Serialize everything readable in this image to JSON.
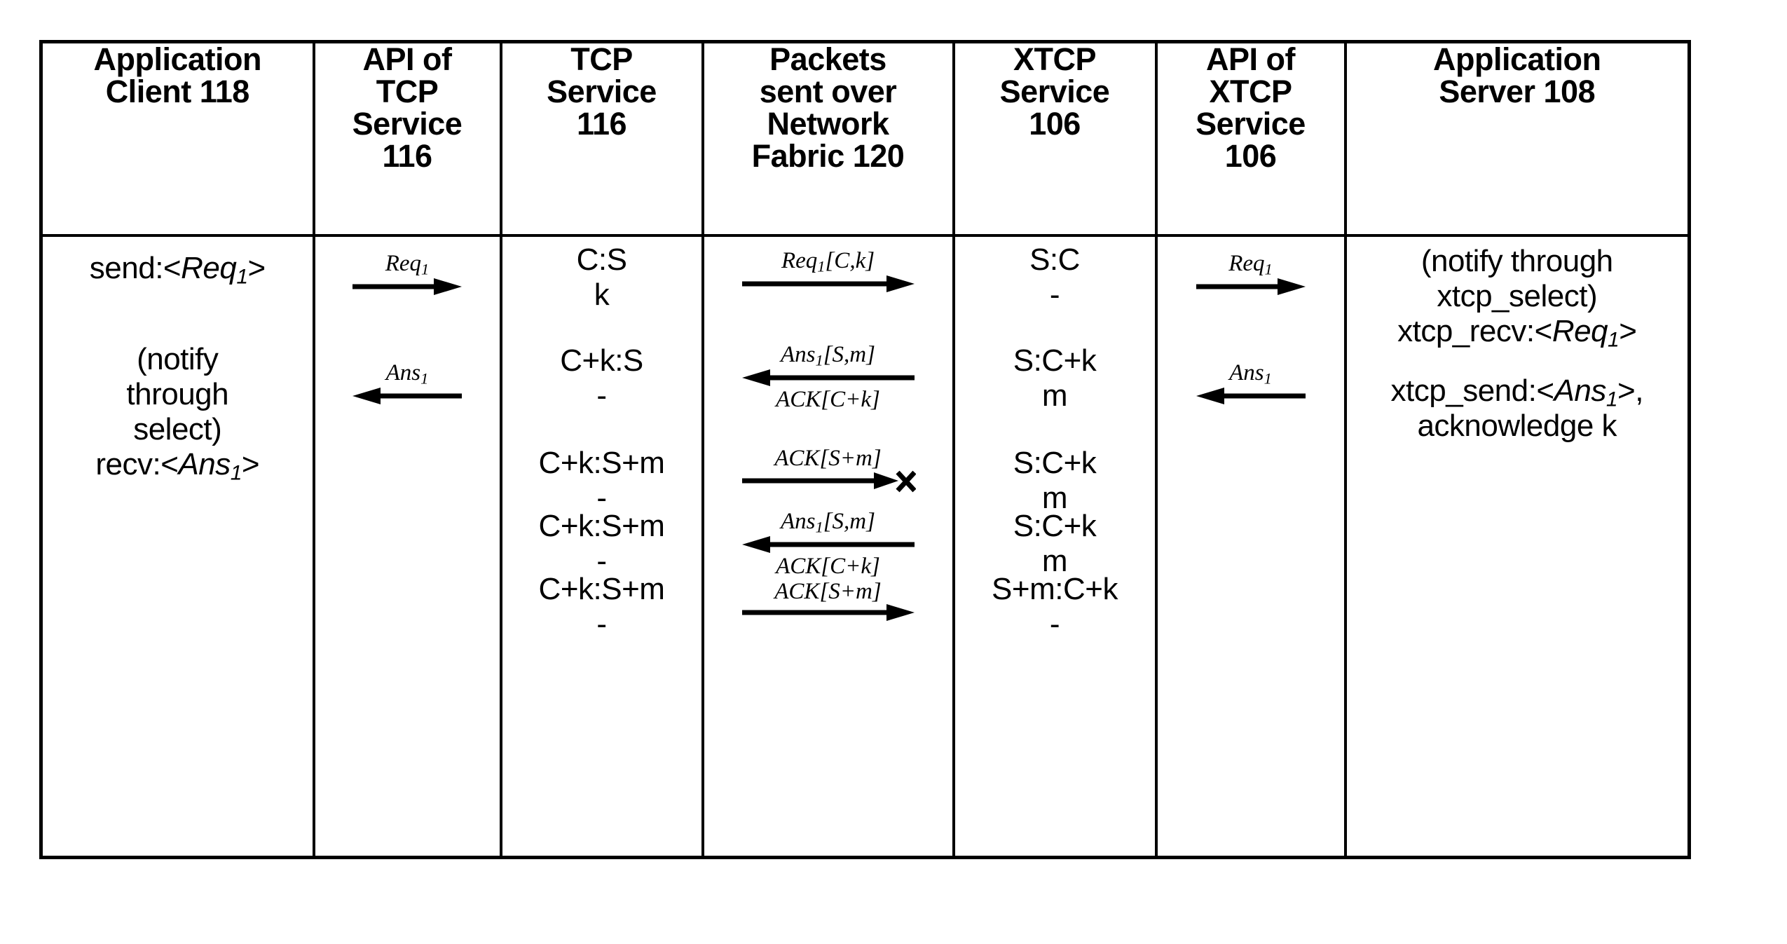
{
  "figure": {
    "type": "sequence-table",
    "columns": [
      {
        "id": "app-client",
        "header_lines": [
          "Application",
          "Client 118"
        ]
      },
      {
        "id": "api-tcp",
        "header_lines": [
          "API of",
          "TCP",
          "Service",
          "116"
        ]
      },
      {
        "id": "tcp-service",
        "header_lines": [
          "TCP",
          "Service",
          "116"
        ]
      },
      {
        "id": "packets",
        "header_lines": [
          "Packets",
          "sent over",
          "Network",
          "Fabric 120"
        ]
      },
      {
        "id": "xtcp-service",
        "header_lines": [
          "XTCP",
          "Service",
          "106"
        ]
      },
      {
        "id": "api-xtcp",
        "header_lines": [
          "API of",
          "XTCP",
          "Service",
          "106"
        ]
      },
      {
        "id": "app-server",
        "header_lines": [
          "Application",
          "Server 108"
        ]
      }
    ]
  },
  "app_client": {
    "send_req": {
      "prefix": "send:<",
      "name": "Req",
      "sub": "1",
      "suffix": ">"
    },
    "notify_line1": "(notify",
    "notify_line2": "through",
    "notify_line3": "select)",
    "recv_ans": {
      "prefix": "recv:<",
      "name": "Ans",
      "sub": "1",
      "suffix": ">"
    }
  },
  "api_tcp": {
    "arrow1": {
      "label_name": "Req",
      "label_sub": "1",
      "direction": "right"
    },
    "arrow2": {
      "label_name": "Ans",
      "label_sub": "1",
      "direction": "left"
    }
  },
  "tcp_service": {
    "states": [
      {
        "line1": "C:S",
        "line2": "k"
      },
      {
        "line1": "C+k:S",
        "line2": "-"
      },
      {
        "line1": "C+k:S+m",
        "line2": "-"
      },
      {
        "line1": "C+k:S+m",
        "line2": "-"
      },
      {
        "line1": "C+k:S+m",
        "line2": "-"
      }
    ]
  },
  "packets": {
    "messages": [
      {
        "above": "Req₁[C,k]",
        "above_name": "Req",
        "above_sub": "1",
        "above_rest": "[C,k]",
        "below": "",
        "direction": "right",
        "lost": false
      },
      {
        "above": "Ans₁[S,m]",
        "above_name": "Ans",
        "above_sub": "1",
        "above_rest": "[S,m]",
        "below": "ACK[C+k]",
        "direction": "left",
        "lost": false
      },
      {
        "above": "ACK[S+m]",
        "above_name": "",
        "above_sub": "",
        "above_rest": "ACK[S+m]",
        "below": "",
        "direction": "right",
        "lost": true
      },
      {
        "above": "Ans₁[S,m]",
        "above_name": "Ans",
        "above_sub": "1",
        "above_rest": "[S,m]",
        "below": "ACK[C+k]",
        "direction": "left",
        "lost": false
      },
      {
        "above": "ACK[S+m]",
        "above_name": "",
        "above_sub": "",
        "above_rest": "ACK[S+m]",
        "below": "",
        "direction": "right",
        "lost": false
      }
    ],
    "lost_marker": "×"
  },
  "xtcp_service": {
    "states": [
      {
        "line1": "S:C",
        "line2": "-"
      },
      {
        "line1": "S:C+k",
        "line2": "m"
      },
      {
        "line1": "S:C+k",
        "line2": "m"
      },
      {
        "line1": "S:C+k",
        "line2": "m"
      },
      {
        "line1": "S+m:C+k",
        "line2": "-"
      }
    ]
  },
  "api_xtcp": {
    "arrow1": {
      "label_name": "Req",
      "label_sub": "1",
      "direction": "right"
    },
    "arrow2": {
      "label_name": "Ans",
      "label_sub": "1",
      "direction": "left"
    }
  },
  "app_server": {
    "notify_line1": "(notify through",
    "notify_line2": "xtcp_select)",
    "xtcp_recv": {
      "prefix": "xtcp_recv:<",
      "name": "Req",
      "sub": "1",
      "suffix": ">"
    },
    "xtcp_send": {
      "prefix": "xtcp_send:<",
      "name": "Ans",
      "sub": "1",
      "suffix": ">,"
    },
    "acknowledge": "acknowledge k"
  },
  "colors": {
    "ink": "#000000",
    "paper": "#ffffff"
  }
}
